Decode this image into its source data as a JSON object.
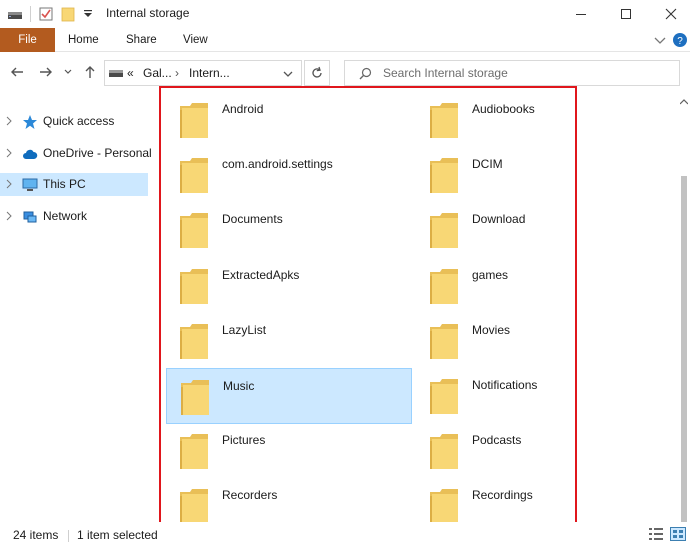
{
  "window": {
    "title": "Internal storage"
  },
  "ribbon": {
    "tabs": [
      "File",
      "Home",
      "Share",
      "View"
    ]
  },
  "address": {
    "path": [
      "Gal...",
      "Intern..."
    ],
    "search_placeholder": "Search Internal storage"
  },
  "nav_pane": {
    "items": [
      "Quick access",
      "OneDrive - Personal",
      "This PC",
      "Network"
    ],
    "selected": "This PC"
  },
  "content": {
    "left_column": [
      "Android",
      "com.android.settings",
      "Documents",
      "ExtractedApks",
      "LazyList",
      "Music",
      "Pictures",
      "Recorders"
    ],
    "right_column": [
      "Audiobooks",
      "DCIM",
      "Download",
      "games",
      "Movies",
      "Notifications",
      "Podcasts",
      "Recordings"
    ],
    "selected": "Music"
  },
  "status": {
    "item_count": "24 items",
    "selection": "1 item selected"
  },
  "colors": {
    "file_tab": "#b35b1f",
    "selection": "#cce8ff",
    "highlight_frame": "#e0161c",
    "folder": "#f8d775"
  }
}
